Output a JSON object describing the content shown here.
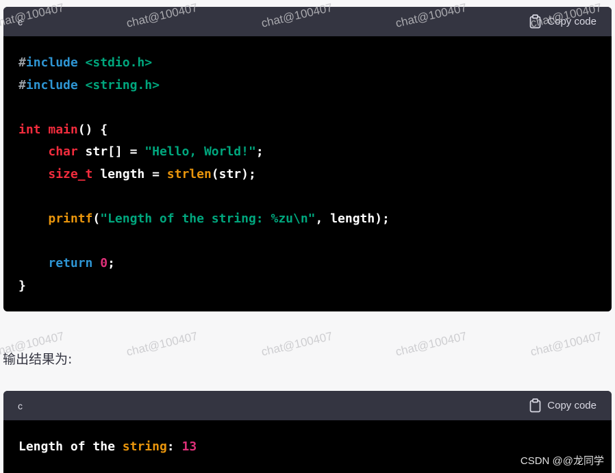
{
  "watermark_text": "chat@100407",
  "code_block_1": {
    "language": "c",
    "copy_label": "Copy code",
    "lines": [
      [
        {
          "t": "#",
          "c": "pp"
        },
        {
          "t": "include",
          "c": "kw"
        },
        {
          "t": " ",
          "c": "plain"
        },
        {
          "t": "<stdio.h>",
          "c": "inc"
        }
      ],
      [
        {
          "t": "#",
          "c": "pp"
        },
        {
          "t": "include",
          "c": "kw"
        },
        {
          "t": " ",
          "c": "plain"
        },
        {
          "t": "<string.h>",
          "c": "inc"
        }
      ],
      [],
      [
        {
          "t": "int",
          "c": "ty"
        },
        {
          "t": " ",
          "c": "plain"
        },
        {
          "t": "main",
          "c": "fn"
        },
        {
          "t": "() {",
          "c": "punc"
        }
      ],
      [
        {
          "t": "    ",
          "c": "plain"
        },
        {
          "t": "char",
          "c": "ty"
        },
        {
          "t": " str[] = ",
          "c": "plain"
        },
        {
          "t": "\"Hello, World!\"",
          "c": "str"
        },
        {
          "t": ";",
          "c": "punc"
        }
      ],
      [
        {
          "t": "    ",
          "c": "plain"
        },
        {
          "t": "size_t",
          "c": "ty"
        },
        {
          "t": " length = ",
          "c": "plain"
        },
        {
          "t": "strlen",
          "c": "call"
        },
        {
          "t": "(str);",
          "c": "plain"
        }
      ],
      [],
      [
        {
          "t": "    ",
          "c": "plain"
        },
        {
          "t": "printf",
          "c": "call"
        },
        {
          "t": "(",
          "c": "plain"
        },
        {
          "t": "\"Length of the string: %zu\\n\"",
          "c": "str"
        },
        {
          "t": ", length);",
          "c": "plain"
        }
      ],
      [],
      [
        {
          "t": "    ",
          "c": "plain"
        },
        {
          "t": "return",
          "c": "kw"
        },
        {
          "t": " ",
          "c": "plain"
        },
        {
          "t": "0",
          "c": "num"
        },
        {
          "t": ";",
          "c": "punc"
        }
      ],
      [
        {
          "t": "}",
          "c": "punc"
        }
      ]
    ]
  },
  "output_label": "输出结果为:",
  "code_block_2": {
    "language": "c",
    "copy_label": "Copy code",
    "lines": [
      [
        {
          "t": "Length",
          "c": "out-plain"
        },
        {
          "t": " ",
          "c": "plain"
        },
        {
          "t": "of",
          "c": "out-kw"
        },
        {
          "t": " ",
          "c": "plain"
        },
        {
          "t": "the",
          "c": "out-kw"
        },
        {
          "t": " ",
          "c": "plain"
        },
        {
          "t": "string",
          "c": "out-str"
        },
        {
          "t": ": ",
          "c": "out-plain"
        },
        {
          "t": "13",
          "c": "out-num"
        }
      ]
    ]
  },
  "footer_attribution": "CSDN @@龙同学"
}
